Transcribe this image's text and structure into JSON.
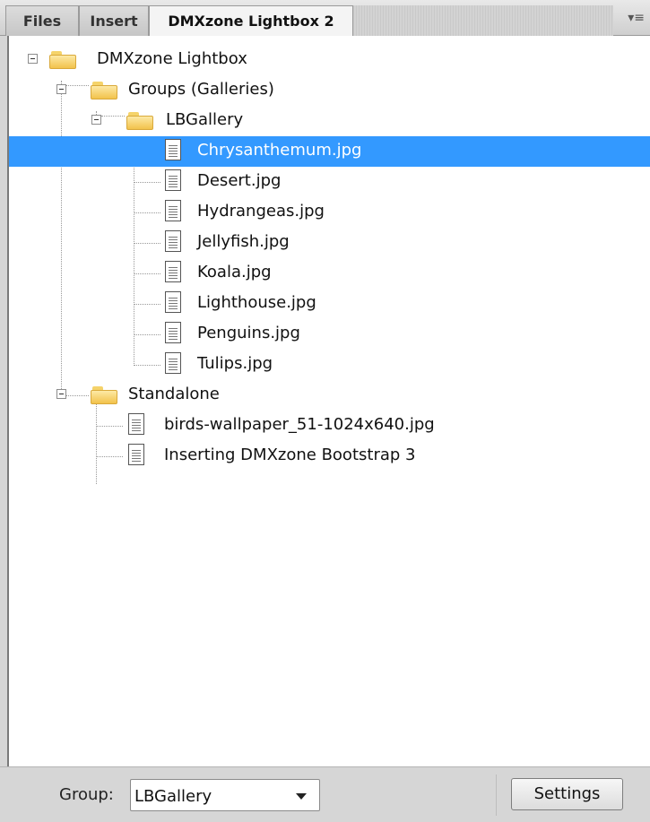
{
  "tabs": [
    {
      "label": "Files"
    },
    {
      "label": "Insert"
    },
    {
      "label": "DMXzone Lightbox 2"
    }
  ],
  "panel_menu_icon": "▾≡",
  "tree": {
    "root": "DMXzone Lightbox",
    "groups": [
      {
        "label": "Groups (Galleries)",
        "subgroups": [
          {
            "label": "LBGallery",
            "files": [
              "Chrysanthemum.jpg",
              "Desert.jpg",
              "Hydrangeas.jpg",
              "Jellyfish.jpg",
              "Koala.jpg",
              "Lighthouse.jpg",
              "Penguins.jpg",
              "Tulips.jpg"
            ]
          }
        ]
      },
      {
        "label": "Standalone",
        "files": [
          "birds-wallpaper_51-1024x640.jpg",
          "Inserting DMXzone Bootstrap 3"
        ]
      }
    ],
    "selected_file": "Chrysanthemum.jpg"
  },
  "footer": {
    "group_label": "Group:",
    "group_value": "LBGallery",
    "settings_label": "Settings"
  },
  "colors": {
    "selection": "#3399ff",
    "folder": "#f2c24b"
  }
}
